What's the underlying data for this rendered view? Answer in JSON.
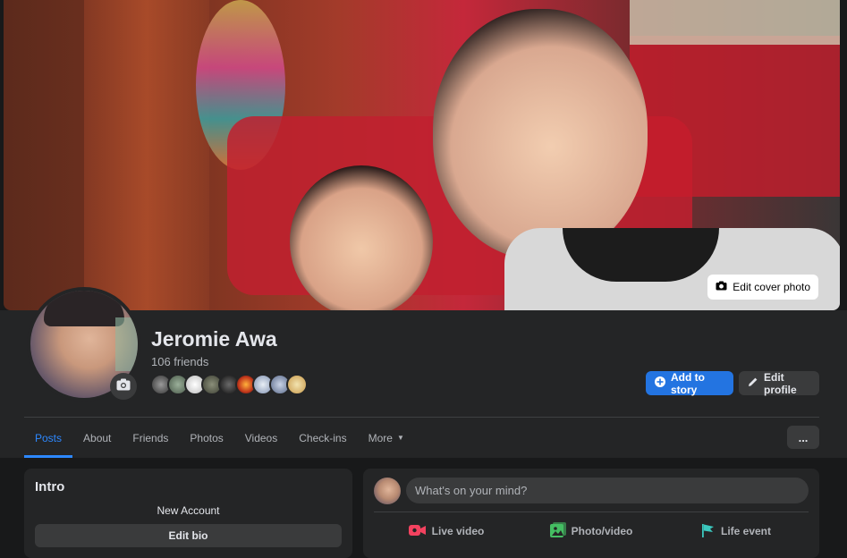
{
  "cover": {
    "edit_cover_label": "Edit cover photo",
    "icon": "camera-icon"
  },
  "profile": {
    "name": "Jeromie Awa",
    "friends_count": "106 friends",
    "avatar_camera_icon": "camera-icon",
    "friend_avatar_count": 9
  },
  "actions": {
    "add_story_label": "Add to story",
    "add_story_icon": "plus-circle-icon",
    "edit_profile_label": "Edit profile",
    "edit_profile_icon": "pencil-icon"
  },
  "tabs": [
    {
      "label": "Posts",
      "active": true
    },
    {
      "label": "About"
    },
    {
      "label": "Friends"
    },
    {
      "label": "Photos"
    },
    {
      "label": "Videos"
    },
    {
      "label": "Check-ins"
    },
    {
      "label": "More"
    }
  ],
  "more_menu_label": "...",
  "intro": {
    "title": "Intro",
    "bio": "New Account",
    "edit_bio_label": "Edit bio"
  },
  "composer": {
    "placeholder": "What's on your mind?",
    "actions": [
      {
        "label": "Live video",
        "icon": "live-video-icon",
        "color": "#f3425f"
      },
      {
        "label": "Photo/video",
        "icon": "photo-icon",
        "color": "#45bd62"
      },
      {
        "label": "Life event",
        "icon": "flag-icon",
        "color": "#3bc7bd"
      }
    ]
  },
  "colors": {
    "background": "#18191a",
    "card": "#242526",
    "accent": "#2374e1",
    "active_tab": "#2d88ff"
  }
}
